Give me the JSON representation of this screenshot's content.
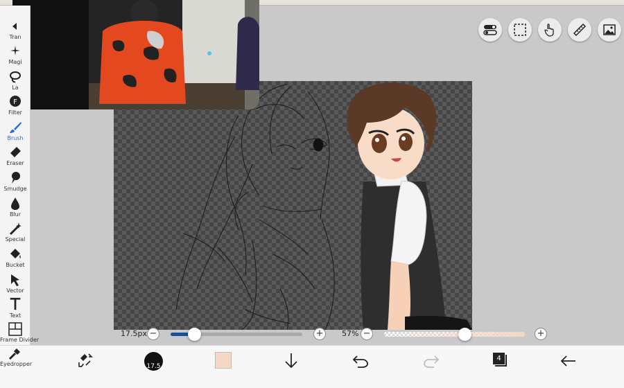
{
  "toolbar": {
    "tools": [
      {
        "label": "Transform",
        "icon": "transform-icon"
      },
      {
        "label": "Magic Wand",
        "icon": "magic-wand-icon"
      },
      {
        "label": "Lasso",
        "icon": "lasso-icon"
      },
      {
        "label": "Filter",
        "icon": "filter-icon"
      },
      {
        "label": "Brush",
        "icon": "brush-icon",
        "active": true
      },
      {
        "label": "Eraser",
        "icon": "eraser-icon"
      },
      {
        "label": "Smudge",
        "icon": "smudge-icon"
      },
      {
        "label": "Blur",
        "icon": "blur-icon"
      },
      {
        "label": "Special",
        "icon": "special-icon"
      },
      {
        "label": "Bucket",
        "icon": "bucket-icon"
      },
      {
        "label": "Vector",
        "icon": "vector-icon"
      },
      {
        "label": "Text",
        "icon": "text-icon"
      },
      {
        "label": "Frame Divider",
        "icon": "frame-divider-icon"
      },
      {
        "label": "Eyedropper",
        "icon": "eyedropper-icon"
      }
    ],
    "partial_labels": {
      "transform": "Tran",
      "magic": "Magi",
      "lasso": "La",
      "filter": "Filter"
    },
    "active_color": "#2a6fd6"
  },
  "top_tools": [
    "toggle-icon",
    "selection-icon",
    "touch-icon",
    "ruler-icon",
    "material-icon"
  ],
  "sliders": {
    "brush_size_label": "17.5px",
    "brush_size_fraction": 0.18,
    "opacity_label": "57%",
    "opacity_fraction": 0.57,
    "minus": "−",
    "plus": "+"
  },
  "bottom_bar": {
    "brush_size_value": "17.5",
    "color_hex": "#f6d6c4",
    "layer_count": "4",
    "icons": [
      "swap-color-icon",
      "brush-size-icon",
      "color-swatch",
      "download-icon",
      "undo-icon",
      "redo-icon",
      "layers-icon",
      "back-icon"
    ]
  }
}
